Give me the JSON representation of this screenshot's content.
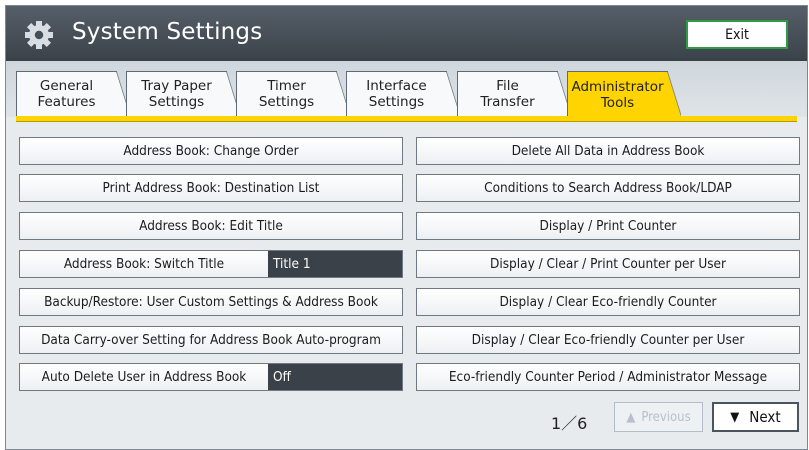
{
  "header": {
    "title": "System Settings",
    "exit_label": "Exit"
  },
  "tabs": [
    {
      "line1": "General",
      "line2": "Features",
      "active": false
    },
    {
      "line1": "Tray Paper",
      "line2": "Settings",
      "active": false
    },
    {
      "line1": "Timer",
      "line2": "Settings",
      "active": false
    },
    {
      "line1": "Interface",
      "line2": "Settings",
      "active": false
    },
    {
      "line1": "File",
      "line2": "Transfer",
      "active": false
    },
    {
      "line1": "Administrator",
      "line2": "Tools",
      "active": true
    }
  ],
  "left_buttons": [
    {
      "label": "Address Book: Change Order"
    },
    {
      "label": "Print Address Book: Destination List"
    },
    {
      "label": "Address Book: Edit Title"
    },
    {
      "label": "Address Book: Switch Title",
      "value": "Title 1"
    },
    {
      "label": "Backup/Restore: User Custom Settings & Address Book"
    },
    {
      "label": "Data Carry-over Setting for Address Book Auto-program"
    },
    {
      "label": "Auto Delete User in Address Book",
      "value": "Off"
    }
  ],
  "right_buttons": [
    {
      "label": "Delete All Data in Address Book"
    },
    {
      "label": "Conditions to Search Address Book/LDAP"
    },
    {
      "label": "Display / Print Counter"
    },
    {
      "label": "Display / Clear / Print Counter per User"
    },
    {
      "label": "Display / Clear Eco-friendly Counter"
    },
    {
      "label": "Display / Clear Eco-friendly Counter per User"
    },
    {
      "label": "Eco-friendly Counter Period / Administrator Message"
    }
  ],
  "pager": {
    "page_text": "1／6",
    "prev_label": "Previous",
    "next_label": "Next"
  },
  "colors": {
    "active_tab": "#ffd400",
    "exit_border": "#2e9a43",
    "value_box": "#3a4148"
  },
  "icons": {
    "header": "gear-icon",
    "prev": "up-triangle-icon",
    "next": "down-triangle-icon"
  }
}
